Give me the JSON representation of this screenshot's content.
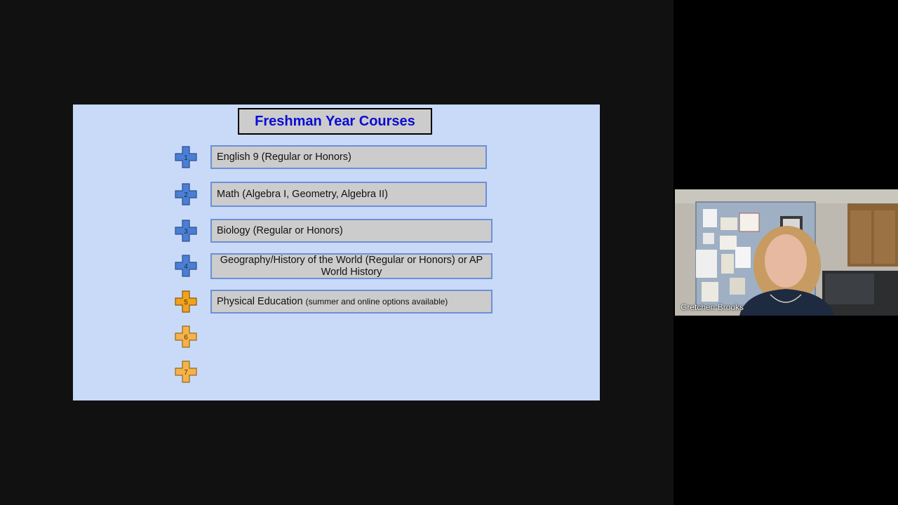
{
  "slide": {
    "title": "Freshman Year Courses",
    "accent_color": "#0b0bd4",
    "background_color": "#c9daf8",
    "items": [
      {
        "number": "1",
        "color": "#4a7fd4",
        "text": "English 9 (Regular or Honors)",
        "note": ""
      },
      {
        "number": "2",
        "color": "#4a7fd4",
        "text": "Math (Algebra I, Geometry, Algebra II)",
        "note": ""
      },
      {
        "number": "3",
        "color": "#4a7fd4",
        "text": "Biology (Regular or Honors)",
        "note": ""
      },
      {
        "number": "4",
        "color": "#4a7fd4",
        "text": "Geography/History of the World (Regular or Honors) or AP World History",
        "note": ""
      },
      {
        "number": "5",
        "color": "#f0a21e",
        "text": "Physical Education",
        "note": "(summer and online options available)"
      },
      {
        "number": "6",
        "color": "#f5b24a",
        "text": "",
        "note": ""
      },
      {
        "number": "7",
        "color": "#f5b24a",
        "text": "",
        "note": ""
      }
    ]
  },
  "participant": {
    "name": "Gretchen Brooks"
  }
}
